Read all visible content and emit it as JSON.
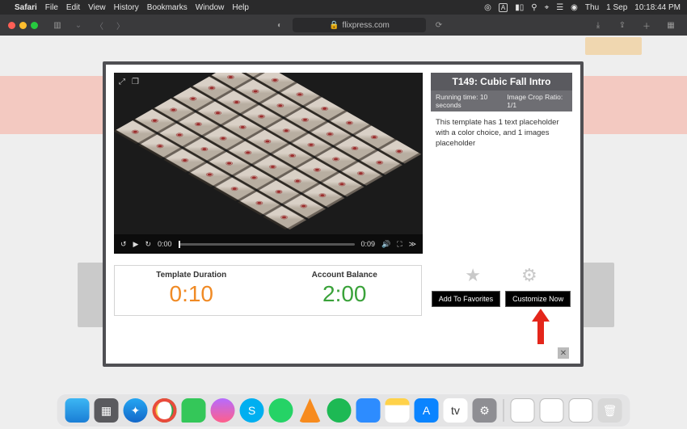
{
  "menubar": {
    "app": "Safari",
    "items": [
      "File",
      "Edit",
      "View",
      "History",
      "Bookmarks",
      "Window",
      "Help"
    ],
    "right": {
      "day": "Thu",
      "date": "1 Sep",
      "time": "10:18:44 PM"
    }
  },
  "toolbar": {
    "url": "flixpress.com"
  },
  "modal": {
    "title": "T149: Cubic Fall Intro",
    "meta": {
      "runtime_label": "Running time:",
      "runtime_value": "10 seconds",
      "crop_label": "Image Crop Ratio:",
      "crop_value": "1/1"
    },
    "description": "This template has 1 text placeholder with a color choice, and 1 images placeholder",
    "video": {
      "current": "0:00",
      "duration": "0:09"
    },
    "stats": {
      "duration_label": "Template Duration",
      "duration_value": "0:10",
      "balance_label": "Account Balance",
      "balance_value": "2:00"
    },
    "actions": {
      "fav": "Add To Favorites",
      "customize": "Customize Now"
    }
  },
  "dock": {
    "apps": [
      "Finder",
      "Launchpad",
      "Safari",
      "Chrome",
      "Messages",
      "Messenger",
      "Skype",
      "WhatsApp",
      "VLC",
      "Spotify",
      "Zoom",
      "Notes",
      "App Store",
      "TV",
      "System Settings"
    ],
    "right": [
      "Document",
      "Document",
      "Document",
      "Trash"
    ]
  }
}
